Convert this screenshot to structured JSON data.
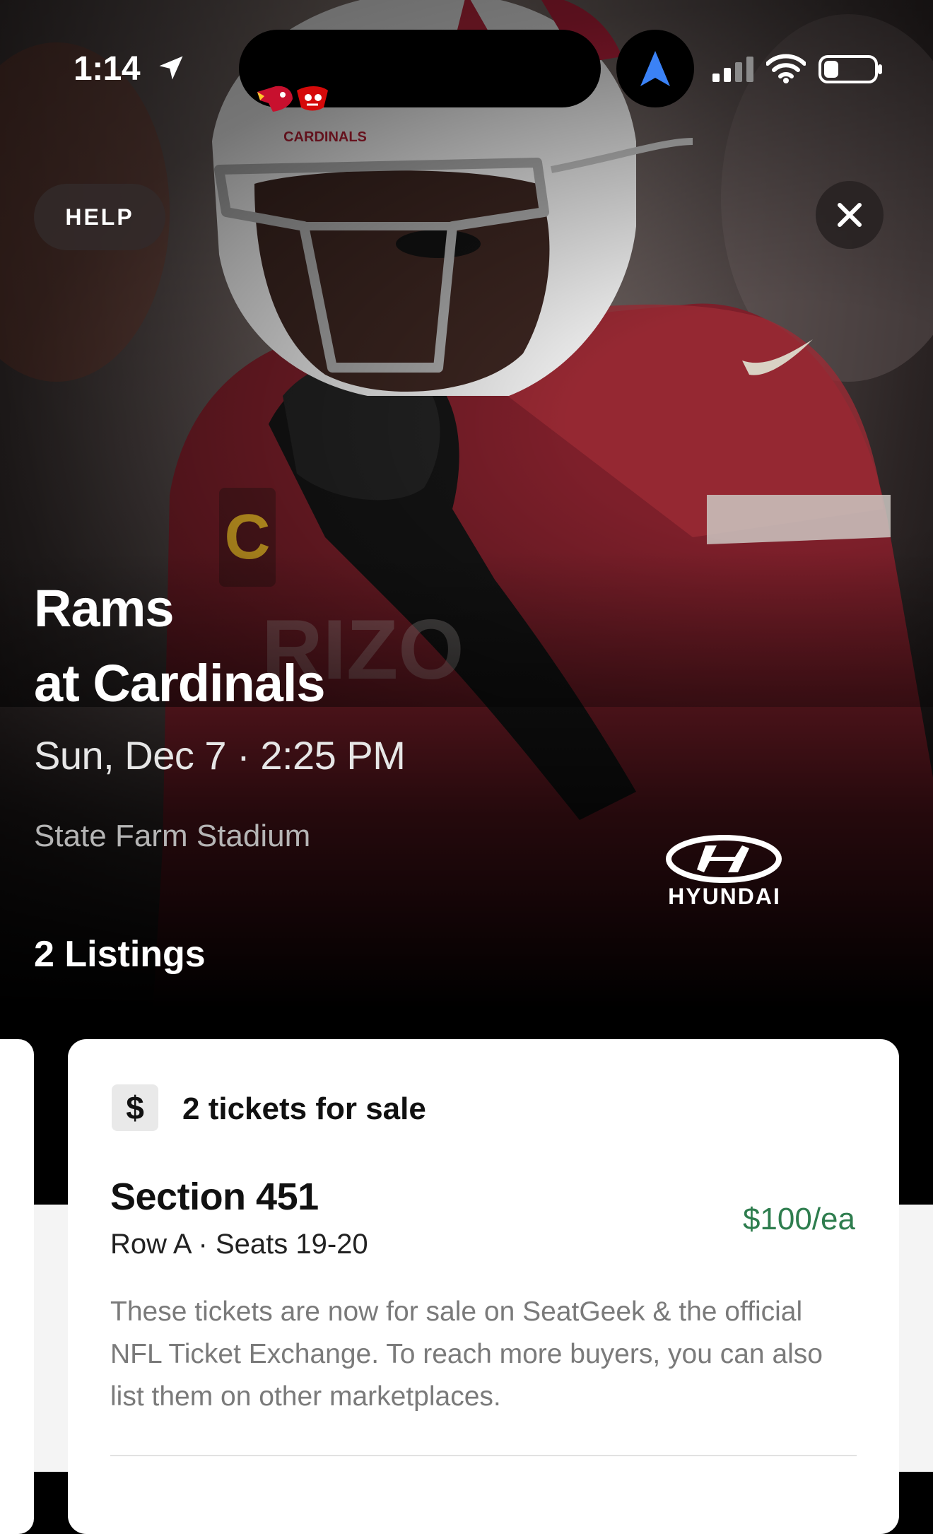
{
  "status_bar": {
    "time": "1:14"
  },
  "header": {
    "help_label": "HELP"
  },
  "event": {
    "title_line1": "Rams",
    "title_line2": "at Cardinals",
    "date_time": "Sun, Dec 7 · 2:25 PM",
    "venue": "State Farm Stadium"
  },
  "sponsor": {
    "name": "HYUNDAI"
  },
  "listings": {
    "count_label": "2 Listings",
    "items": [
      {
        "currency_symbol": "$",
        "tickets_label": "2 tickets for sale",
        "section": "Section 451",
        "row_seats": "Row A · Seats 19-20",
        "price": "$100/ea",
        "notice": "These tickets are now for sale on SeatGeek & the official NFL Ticket Exchange. To reach more buyers, you can also list them on other marketplaces."
      }
    ]
  },
  "colors": {
    "price": "#2e7d4e",
    "cardinals_red": "#97233f",
    "buccaneers_red": "#d50a0a",
    "nav_arrow_blue": "#3b82f6"
  },
  "icons": {
    "location": "location-arrow-icon",
    "navigation": "navigation-arrow-icon",
    "signal": "cellular-signal-icon",
    "wifi": "wifi-icon",
    "battery": "battery-icon",
    "close": "close-icon"
  }
}
